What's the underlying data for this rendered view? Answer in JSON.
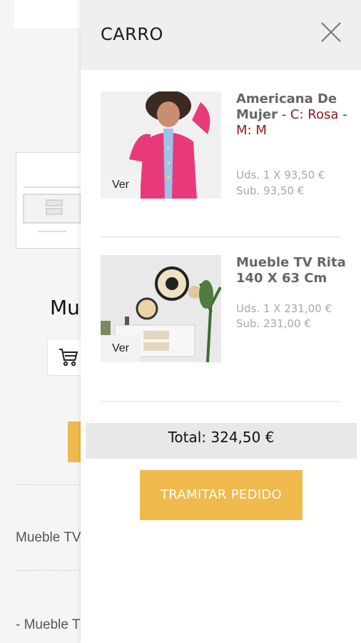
{
  "background": {
    "product_title_partial": "Mu",
    "text_line_1": "Mueble TV",
    "text_line_2": "- Mueble T"
  },
  "cart": {
    "title": "CARRO",
    "items": [
      {
        "name": "Americana De Mujer",
        "variant": " - C: Rosa - M: M",
        "quantity_line": "Uds. 1 X 93,50 €",
        "subtotal_line": "Sub. 93,50 €",
        "view_label": "Ver"
      },
      {
        "name": "Mueble TV Rita 140 X 63 Cm",
        "variant": "",
        "quantity_line": "Uds. 1 X 231,00 €",
        "subtotal_line": "Sub. 231,00 €",
        "view_label": "Ver"
      }
    ],
    "total_line": "Total: 324,50 €",
    "checkout_label": "TRAMITAR PEDIDO"
  },
  "colors": {
    "accent": "#efb94c",
    "variant_text": "#8b1b1b",
    "header_bg": "#efefef"
  }
}
